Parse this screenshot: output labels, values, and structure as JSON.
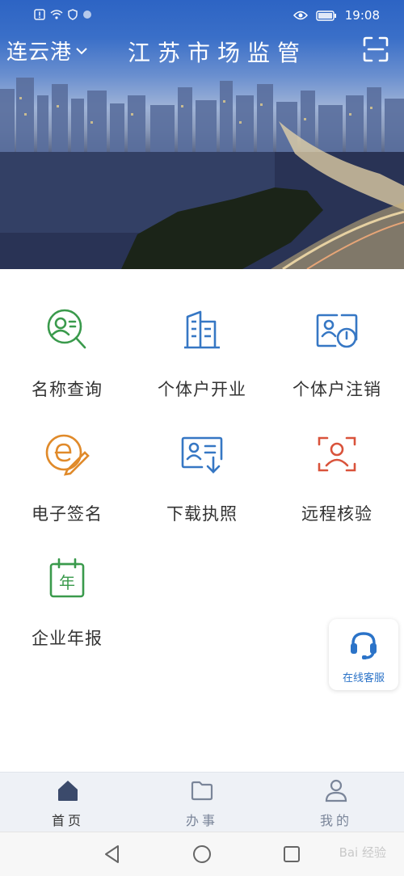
{
  "status_bar": {
    "time": "19:08"
  },
  "header": {
    "city": "连云港",
    "title": "江苏市场监管"
  },
  "services": [
    {
      "label": "名称查询",
      "icon": "name-search-icon",
      "color": "#3a9a4c"
    },
    {
      "label": "个体户开业",
      "icon": "business-building-icon",
      "color": "#3677c4"
    },
    {
      "label": "个体户注销",
      "icon": "deregister-icon",
      "color": "#3677c4"
    },
    {
      "label": "电子签名",
      "icon": "e-signature-icon",
      "color": "#e08a2a"
    },
    {
      "label": "下载执照",
      "icon": "download-license-icon",
      "color": "#3677c4"
    },
    {
      "label": "远程核验",
      "icon": "remote-verify-icon",
      "color": "#d9533b"
    },
    {
      "label": "企业年报",
      "icon": "annual-report-icon",
      "color": "#3a9a4c",
      "glyph": "年"
    }
  ],
  "floating": {
    "label": "在线客服",
    "icon": "headset-icon",
    "color": "#2b73c8"
  },
  "tabbar": [
    {
      "label": "首页",
      "icon": "home-icon",
      "active": true
    },
    {
      "label": "办事",
      "icon": "folder-icon",
      "active": false
    },
    {
      "label": "我的",
      "icon": "user-icon",
      "active": false
    }
  ],
  "watermark": "Bai 经验"
}
